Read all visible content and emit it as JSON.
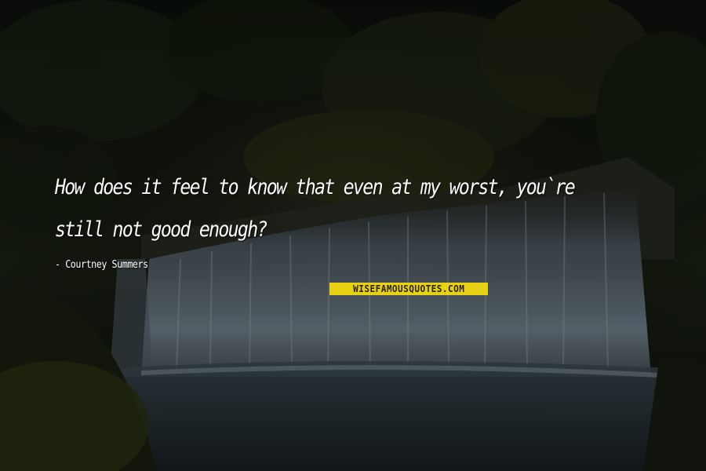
{
  "quote": {
    "text": "How does it feel to know that even at my worst, you`re still not good enough?",
    "author": "- Courtney Summers"
  },
  "watermark": {
    "label": "WISEFAMOUSQUOTES.COM",
    "background": "#e8d012"
  },
  "colors": {
    "text": "#ffffff",
    "forest": "#1a2412",
    "water": "#6f7f8c"
  }
}
